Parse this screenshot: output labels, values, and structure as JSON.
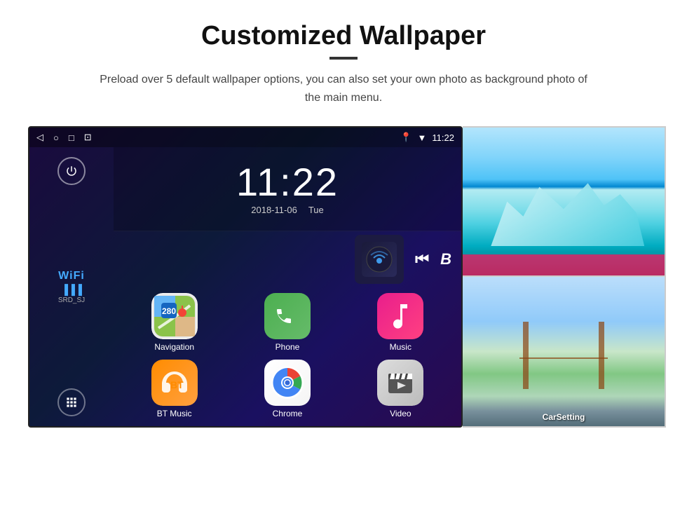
{
  "page": {
    "title": "Customized Wallpaper",
    "subtitle": "Preload over 5 default wallpaper options, you can also set your own photo as background photo of the main menu."
  },
  "device": {
    "time": "11:22",
    "date": "2018-11-06",
    "day": "Tue",
    "wifi_label": "WiFi",
    "wifi_ssid": "SRD_SJ",
    "status_time": "11:22"
  },
  "apps": [
    {
      "label": "Navigation",
      "icon_type": "navigation"
    },
    {
      "label": "Phone",
      "icon_type": "phone"
    },
    {
      "label": "Music",
      "icon_type": "music"
    },
    {
      "label": "BT Music",
      "icon_type": "btmusic"
    },
    {
      "label": "Chrome",
      "icon_type": "chrome"
    },
    {
      "label": "Video",
      "icon_type": "video"
    }
  ],
  "wallpapers": [
    {
      "label": "",
      "type": "glacier"
    },
    {
      "label": "CarSetting",
      "type": "bridge"
    }
  ]
}
